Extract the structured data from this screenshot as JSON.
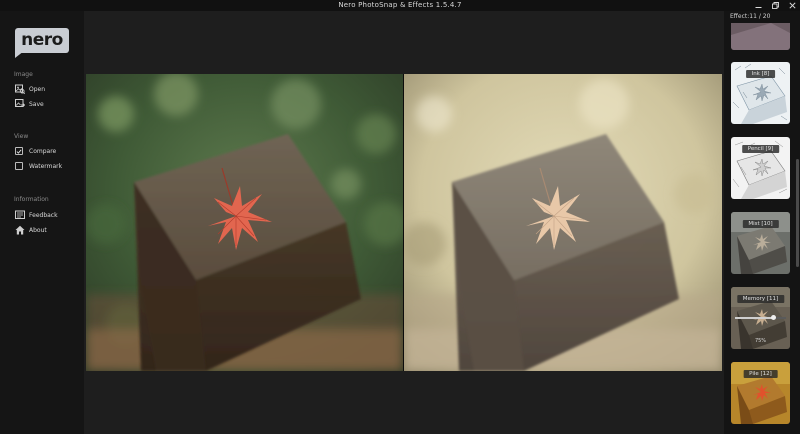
{
  "app": {
    "title": "Nero PhotoSnap & Effects 1.5.4.7",
    "logo": "nero"
  },
  "window_controls": [
    {
      "icon": "minimize-icon",
      "glyph": "—"
    },
    {
      "icon": "restore-icon",
      "glyph": "❐"
    },
    {
      "icon": "close-icon",
      "glyph": "✕"
    }
  ],
  "sidebar": {
    "image": {
      "title": "Image",
      "open": "Open",
      "save": "Save"
    },
    "view": {
      "title": "View",
      "compare": {
        "label": "Compare",
        "checked": true
      },
      "watermark": {
        "label": "Watermark",
        "checked": false
      }
    },
    "information": {
      "title": "Information",
      "feedback": "Feedback",
      "about": "About"
    }
  },
  "effects": {
    "counter": "Effect:11 / 20",
    "items": [
      {
        "label": ""
      },
      {
        "label": "Ink [8]"
      },
      {
        "label": "Pencil [9]"
      },
      {
        "label": "Mist [10]"
      },
      {
        "label": "Memory [11]",
        "intensity": "75%",
        "intensity_value": 0.75
      },
      {
        "label": "Pile [12]"
      }
    ]
  },
  "colors": {
    "accent": "#c9cdd3",
    "background": "#1e1e1e",
    "sidebar": "#151515"
  }
}
